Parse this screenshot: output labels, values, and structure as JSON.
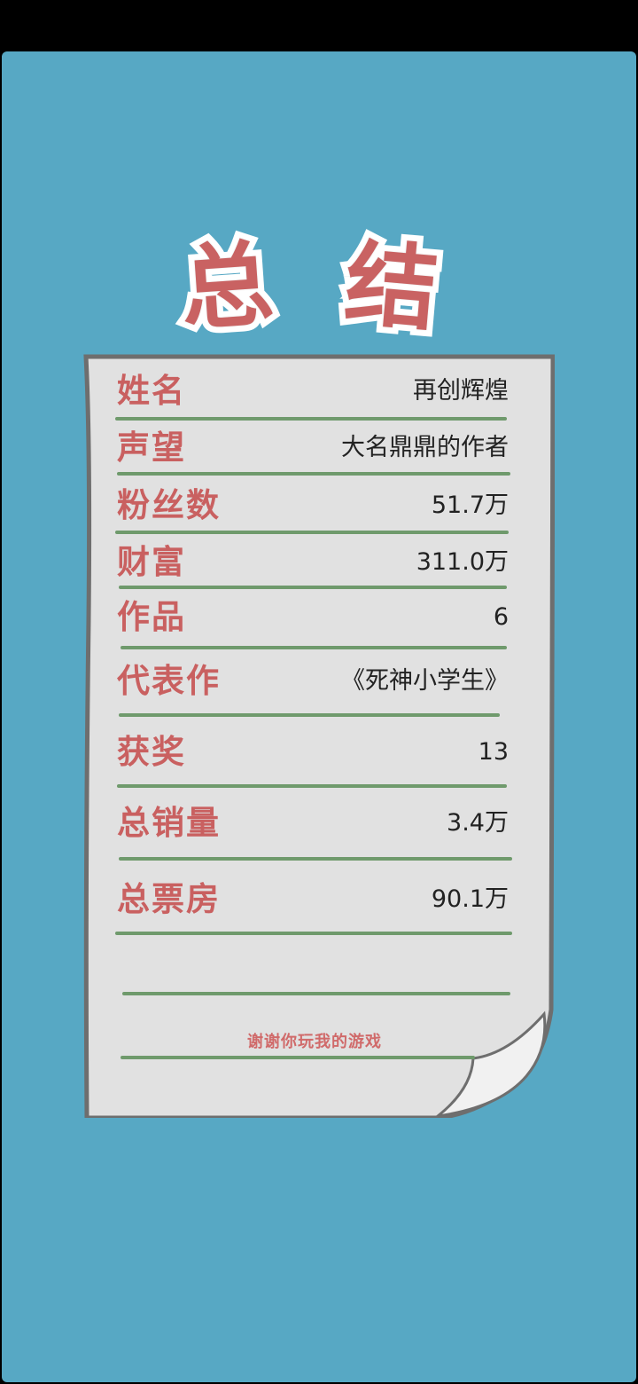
{
  "title": {
    "char1": "总",
    "char2": "结"
  },
  "summary": [
    {
      "label": "姓名",
      "value": "再创辉煌"
    },
    {
      "label": "声望",
      "value": "大名鼎鼎的作者"
    },
    {
      "label": "粉丝数",
      "value": "51.7万"
    },
    {
      "label": "财富",
      "value": "311.0万"
    },
    {
      "label": "作品",
      "value": "6"
    },
    {
      "label": "代表作",
      "value": "《死神小学生》"
    },
    {
      "label": "获奖",
      "value": "13"
    },
    {
      "label": "总销量",
      "value": "3.4万"
    },
    {
      "label": "总票房",
      "value": "90.1万"
    }
  ],
  "footer": {
    "thanks": "谢谢你玩我的游戏"
  },
  "colors": {
    "background": "#57a8c4",
    "label": "#c96060",
    "rule": "#6f9a6c",
    "paper": "#e1e1e1"
  }
}
